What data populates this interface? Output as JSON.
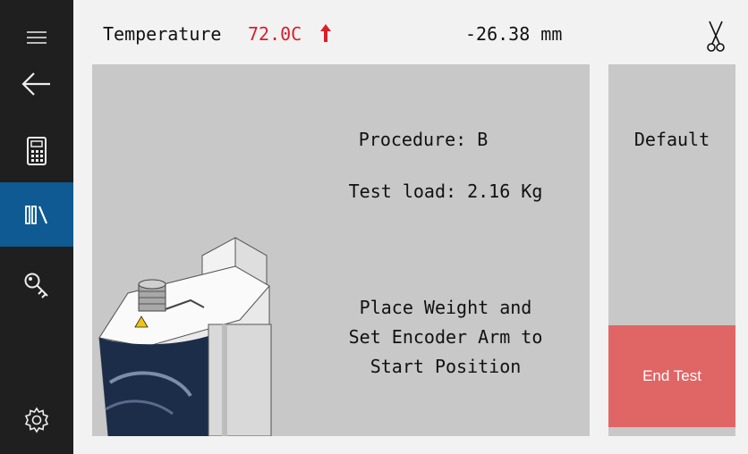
{
  "header": {
    "temperature_label": "Temperature",
    "temperature_value": "72.0C",
    "temperature_trend_icon": "arrow-up-icon",
    "position_readout": "-26.38 mm",
    "right_icon": "scissors-icon",
    "temperature_color": "#d81f2a"
  },
  "sidebar": {
    "items": [
      {
        "icon": "hamburger-menu-icon"
      },
      {
        "icon": "back-arrow-icon"
      },
      {
        "icon": "calculator-icon"
      },
      {
        "icon": "library-icon",
        "active": true
      },
      {
        "icon": "key-icon"
      },
      {
        "icon": "settings-gear-icon"
      }
    ],
    "background_color": "#1f1f1f",
    "active_color": "#0f5a92"
  },
  "main": {
    "procedure_text": "Procedure: B",
    "test_load_text": "Test load: 2.16 Kg",
    "instruction_lines": [
      "Place Weight and",
      "Set Encoder Arm to",
      "Start Position"
    ],
    "image": "instrument-illustration"
  },
  "side_panel": {
    "default_label": "Default",
    "end_test_label": "End Test",
    "end_test_color": "#e06666"
  }
}
